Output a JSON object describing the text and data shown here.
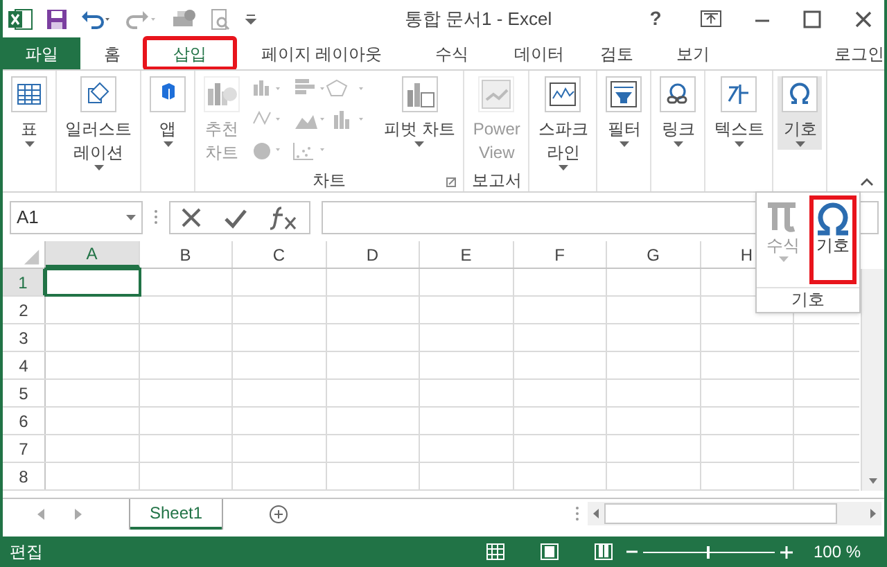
{
  "window": {
    "title": "통합 문서1 - Excel",
    "help": "?"
  },
  "tabs": [
    {
      "label": "파일",
      "kind": "file",
      "selected": false,
      "highlighted": false
    },
    {
      "label": "홈",
      "kind": "tab",
      "selected": false,
      "highlighted": false
    },
    {
      "label": "삽입",
      "kind": "tab",
      "selected": true,
      "highlighted": true
    },
    {
      "label": "페이지 레이아웃",
      "kind": "tab",
      "selected": false,
      "highlighted": false
    },
    {
      "label": "수식",
      "kind": "tab",
      "selected": false,
      "highlighted": false
    },
    {
      "label": "데이터",
      "kind": "tab",
      "selected": false,
      "highlighted": false
    },
    {
      "label": "검토",
      "kind": "tab",
      "selected": false,
      "highlighted": false
    },
    {
      "label": "보기",
      "kind": "tab",
      "selected": false,
      "highlighted": false
    }
  ],
  "account": "로그인",
  "ribbon": {
    "groups": [
      {
        "buttons": [
          {
            "lines": [
              "표"
            ],
            "disabled": false,
            "dropdown": true,
            "expanded": false
          }
        ]
      },
      {
        "buttons": [
          {
            "lines": [
              "일러스트",
              "레이션"
            ],
            "disabled": false,
            "dropdown": true,
            "expanded": false
          }
        ]
      },
      {
        "buttons": [
          {
            "lines": [
              "앱"
            ],
            "disabled": false,
            "dropdown": true,
            "expanded": false
          }
        ]
      },
      {
        "label": "차트",
        "buttons": [
          {
            "lines": [
              "추천",
              "차트"
            ],
            "disabled": true,
            "dropdown": false,
            "expanded": false
          },
          {
            "kind": "chart-icons",
            "disabled": true
          },
          {
            "lines": [
              "피벗 차트"
            ],
            "disabled": false,
            "dropdown": true,
            "expanded": false
          }
        ]
      },
      {
        "label": "보고서",
        "buttons": [
          {
            "lines": [
              "Power",
              "View"
            ],
            "disabled": true,
            "dropdown": false,
            "expanded": false
          }
        ]
      },
      {
        "buttons": [
          {
            "lines": [
              "스파크",
              "라인"
            ],
            "disabled": false,
            "dropdown": true,
            "expanded": false
          }
        ]
      },
      {
        "buttons": [
          {
            "lines": [
              "필터"
            ],
            "disabled": false,
            "dropdown": true,
            "expanded": false
          }
        ]
      },
      {
        "buttons": [
          {
            "lines": [
              "링크"
            ],
            "disabled": false,
            "dropdown": true,
            "expanded": false
          }
        ]
      },
      {
        "buttons": [
          {
            "lines": [
              "텍스트"
            ],
            "disabled": false,
            "dropdown": true,
            "expanded": false
          }
        ]
      },
      {
        "buttons": [
          {
            "lines": [
              "기호"
            ],
            "disabled": false,
            "dropdown": true,
            "expanded": true
          }
        ]
      }
    ]
  },
  "popup": {
    "label": "기호",
    "items": [
      {
        "label": "수식",
        "disabled": true,
        "highlighted": false
      },
      {
        "label": "기호",
        "disabled": false,
        "highlighted": true
      }
    ]
  },
  "formula_bar": {
    "name_box": "A1"
  },
  "columns": [
    {
      "label": "A",
      "selected": true
    },
    {
      "label": "B",
      "selected": false
    },
    {
      "label": "C",
      "selected": false
    },
    {
      "label": "D",
      "selected": false
    },
    {
      "label": "E",
      "selected": false
    },
    {
      "label": "F",
      "selected": false
    },
    {
      "label": "G",
      "selected": false
    },
    {
      "label": "H",
      "selected": false
    }
  ],
  "rows": [
    {
      "label": "1",
      "selected": true
    },
    {
      "label": "2",
      "selected": false
    },
    {
      "label": "3",
      "selected": false
    },
    {
      "label": "4",
      "selected": false
    },
    {
      "label": "5",
      "selected": false
    },
    {
      "label": "6",
      "selected": false
    },
    {
      "label": "7",
      "selected": false
    },
    {
      "label": "8",
      "selected": false
    }
  ],
  "sheets": [
    {
      "label": "Sheet1",
      "selected": true
    }
  ],
  "status": {
    "mode": "편집",
    "zoom": "100 %",
    "level": 0.5
  }
}
